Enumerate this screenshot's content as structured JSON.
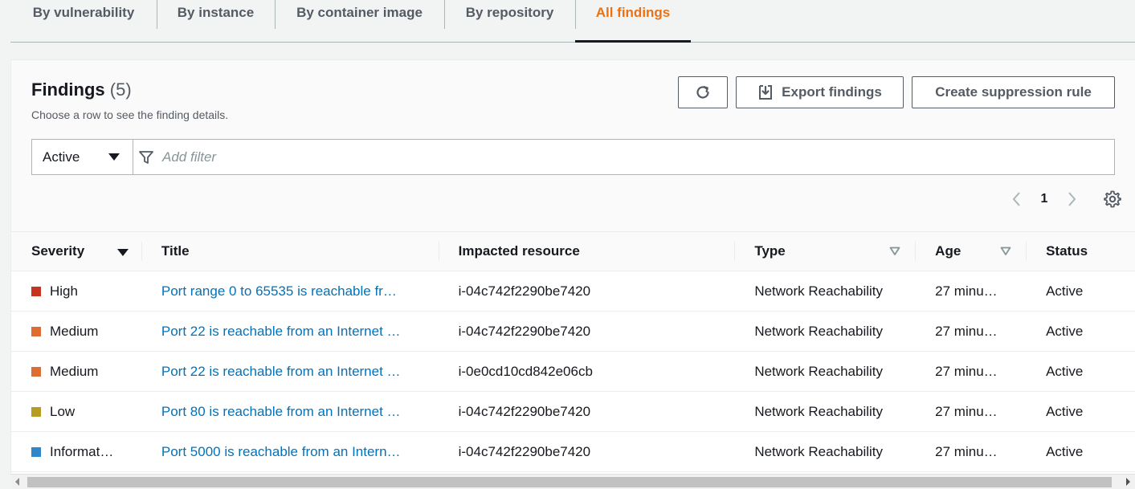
{
  "tabs": [
    {
      "label": "By vulnerability",
      "active": false
    },
    {
      "label": "By instance",
      "active": false
    },
    {
      "label": "By container image",
      "active": false
    },
    {
      "label": "By repository",
      "active": false
    },
    {
      "label": "All findings",
      "active": true
    }
  ],
  "header": {
    "title": "Findings",
    "count": "(5)",
    "subtitle": "Choose a row to see the finding details."
  },
  "buttons": {
    "refresh_icon": "refresh-icon",
    "export_label": "Export findings",
    "export_icon": "download-icon",
    "suppression_label": "Create suppression rule"
  },
  "filter": {
    "status_value": "Active",
    "placeholder": "Add filter",
    "icon": "funnel-icon"
  },
  "pagination": {
    "current_page": "1"
  },
  "table": {
    "columns": [
      "Severity",
      "Title",
      "Impacted resource",
      "Type",
      "Age",
      "Status"
    ],
    "rows": [
      {
        "severity": "High",
        "severity_color": "#c7341d",
        "title": "Port range 0 to 65535 is reachable fr…",
        "resource": "i-04c742f2290be7420",
        "type": "Network Reachability",
        "age": "27 minu…",
        "status": "Active"
      },
      {
        "severity": "Medium",
        "severity_color": "#de6c33",
        "title": "Port 22 is reachable from an Internet …",
        "resource": "i-04c742f2290be7420",
        "type": "Network Reachability",
        "age": "27 minu…",
        "status": "Active"
      },
      {
        "severity": "Medium",
        "severity_color": "#de6c33",
        "title": "Port 22 is reachable from an Internet …",
        "resource": "i-0e0cd10cd842e06cb",
        "type": "Network Reachability",
        "age": "27 minu…",
        "status": "Active"
      },
      {
        "severity": "Low",
        "severity_color": "#b69d21",
        "title": "Port 80 is reachable from an Internet …",
        "resource": "i-04c742f2290be7420",
        "type": "Network Reachability",
        "age": "27 minu…",
        "status": "Active"
      },
      {
        "severity": "Informat…",
        "severity_color": "#2f86c8",
        "title": "Port 5000 is reachable from an Intern…",
        "resource": "i-04c742f2290be7420",
        "type": "Network Reachability",
        "age": "27 minu…",
        "status": "Active"
      }
    ]
  },
  "colors": {
    "accent": "#ec7211",
    "link": "#0073bb"
  }
}
